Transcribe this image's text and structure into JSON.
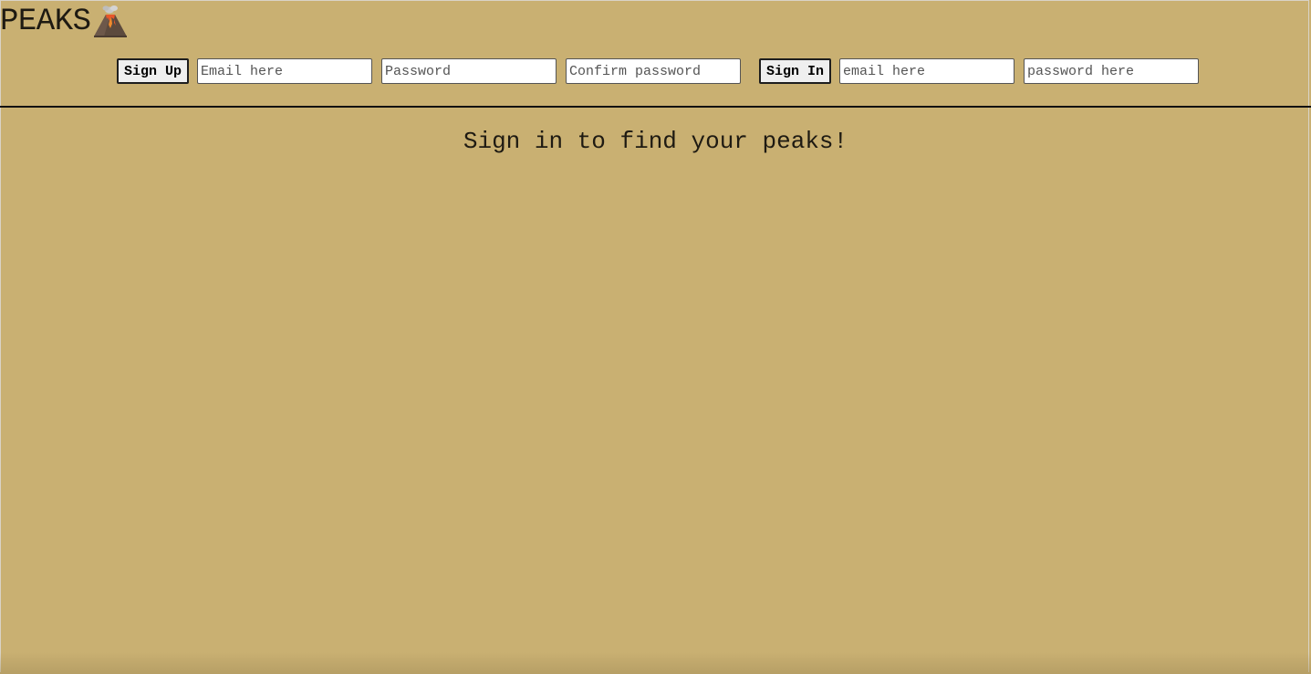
{
  "app": {
    "title": "PEAKS",
    "logo_icon": "volcano-icon"
  },
  "colors": {
    "background": "#c9b072",
    "text": "#1e1a12",
    "divider": "#111111",
    "button_bg": "#efefef",
    "field_bg": "#ffffff"
  },
  "signup": {
    "button_label": "Sign Up",
    "email_placeholder": "Email here",
    "password_placeholder": "Password",
    "confirm_placeholder": "Confirm password"
  },
  "signin": {
    "button_label": "Sign In",
    "email_placeholder": "email here",
    "password_placeholder": "password here"
  },
  "main": {
    "message": "Sign in to find your peaks!"
  }
}
